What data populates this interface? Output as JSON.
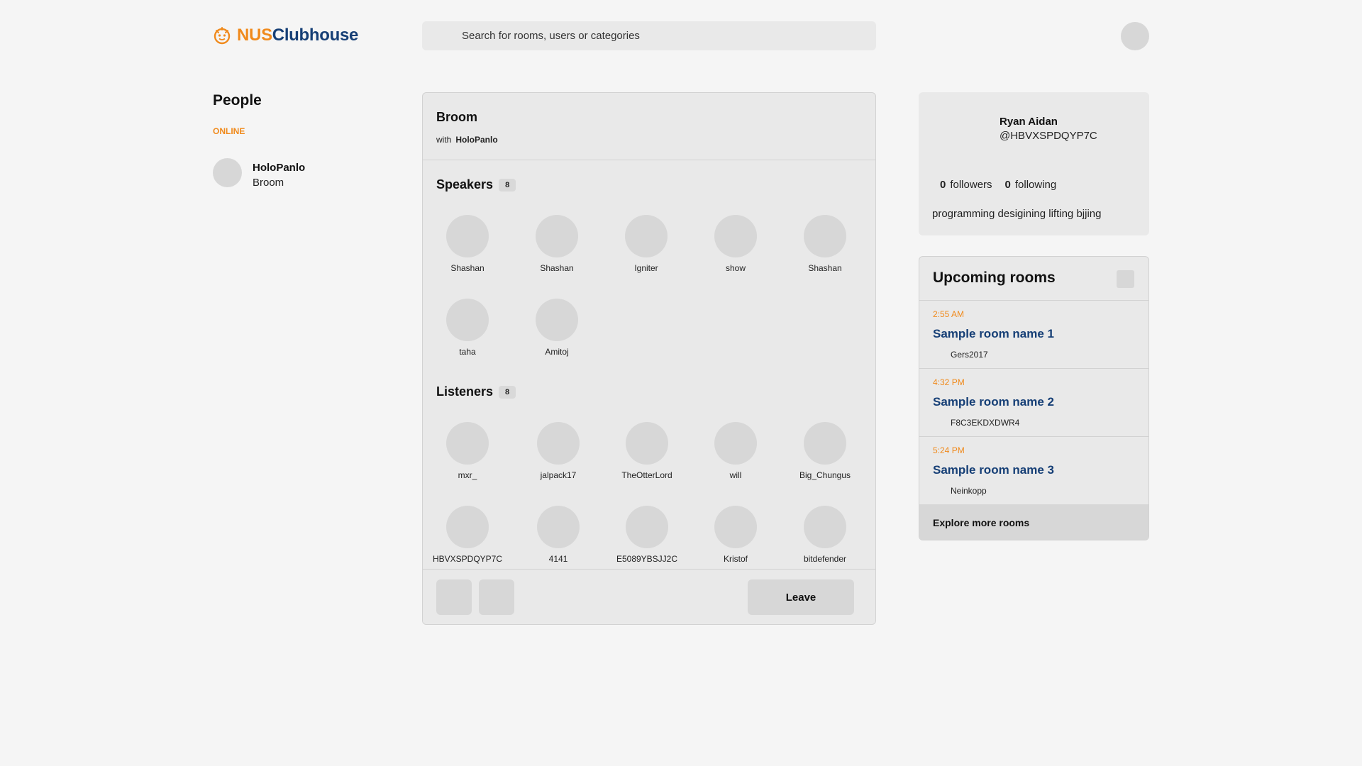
{
  "header": {
    "logo_part1": "NUS",
    "logo_part2": "Clubhouse",
    "search_placeholder": "Search for rooms, users or categories"
  },
  "people": {
    "title": "People",
    "online_label": "ONLINE",
    "online": [
      {
        "name": "HoloPanlo",
        "room": "Broom"
      }
    ]
  },
  "room": {
    "title": "Broom",
    "with_label": "with",
    "host": "HoloPanlo",
    "speakers_label": "Speakers",
    "speakers_count": "8",
    "speakers": [
      "Shashan",
      "Shashan",
      "Igniter",
      "show",
      "Shashan",
      "taha",
      "Amitoj"
    ],
    "listeners_label": "Listeners",
    "listeners_count": "8",
    "listeners": [
      "mxr_",
      "jalpack17",
      "TheOtterLord",
      "will",
      "Big_Chungus",
      "HBVXSPDQYP7C",
      "4141",
      "E5089YBSJJ2C",
      "Kristof",
      "bitdefender"
    ],
    "leave_label": "Leave"
  },
  "profile": {
    "name": "Ryan Aidan",
    "handle": "@HBVXSPDQYP7C",
    "followers_count": "0",
    "followers_label": "followers",
    "following_count": "0",
    "following_label": "following",
    "bio": "programming desigining lifting bjjing"
  },
  "upcoming": {
    "title": "Upcoming rooms",
    "items": [
      {
        "time": "2:55 AM",
        "name": "Sample room name 1",
        "host": "Gers2017"
      },
      {
        "time": "4:32 PM",
        "name": "Sample room name 2",
        "host": "F8C3EKDXDWR4"
      },
      {
        "time": "5:24 PM",
        "name": "Sample room name 3",
        "host": "Neinkopp"
      }
    ],
    "explore_label": "Explore more rooms"
  },
  "colors": {
    "accent_orange": "#f08a1c",
    "brand_blue": "#163f76",
    "panel_bg": "#e9e9e9",
    "page_bg": "#f5f5f5"
  }
}
